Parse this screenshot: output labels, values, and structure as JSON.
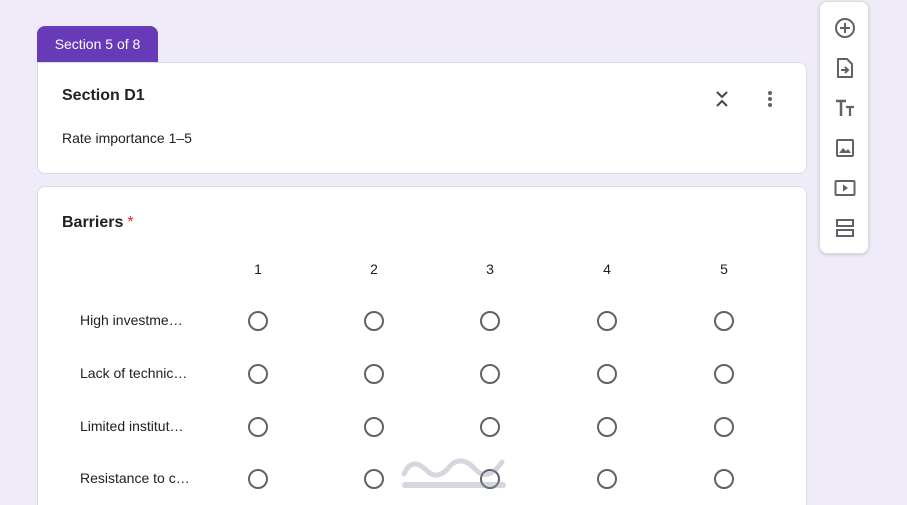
{
  "section_tab": "Section 5 of 8",
  "section": {
    "title": "Section D1",
    "description": "Rate importance 1–5"
  },
  "question": {
    "title": "Barriers",
    "required_marker": "*",
    "columns": [
      "1",
      "2",
      "3",
      "4",
      "5"
    ],
    "rows": [
      "High investme…",
      "Lack of technic…",
      "Limited institut…",
      "Resistance to c…"
    ]
  },
  "toolbar": {
    "items": [
      "add-question-icon",
      "import-questions-icon",
      "add-title-icon",
      "add-image-icon",
      "add-video-icon",
      "add-section-icon"
    ]
  },
  "colors": {
    "accent": "#673ab7",
    "background": "#f0ebf8",
    "required": "#d93025"
  }
}
